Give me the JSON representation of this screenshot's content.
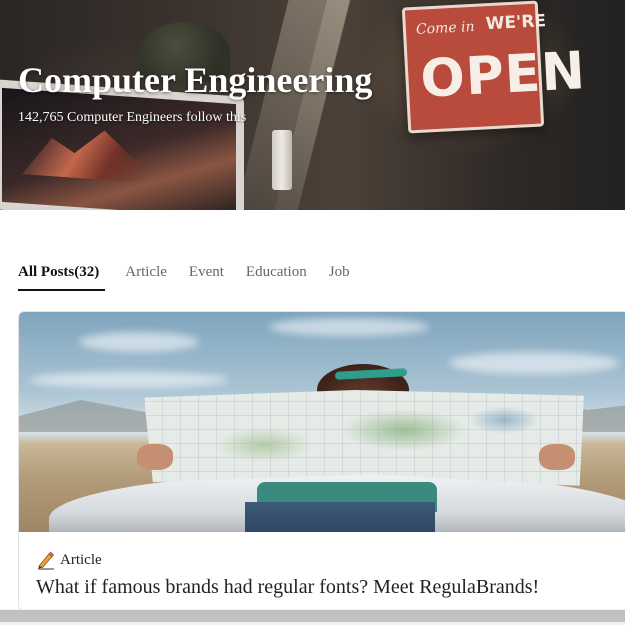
{
  "hero": {
    "title": "Computer Engineering",
    "followers": "142,765 Computer Engineers follow this",
    "sign_line_1": "Come in",
    "sign_line_2": "WE'RE",
    "sign_line_3": "OPEN"
  },
  "tabs": [
    {
      "label": "All Posts(32)",
      "active": true
    },
    {
      "label": "Article",
      "active": false
    },
    {
      "label": "Event",
      "active": false
    },
    {
      "label": "Education",
      "active": false
    },
    {
      "label": "Job",
      "active": false
    }
  ],
  "post": {
    "category_icon": "pencil-icon",
    "category": "Article",
    "title": "What if famous brands had regular fonts? Meet RegulaBrands!"
  },
  "colors": {
    "accent": "#111111",
    "inactive_tab": "#666666",
    "card_border": "#e2e2e2",
    "scrollbar_thumb": "#c1c1c1"
  }
}
